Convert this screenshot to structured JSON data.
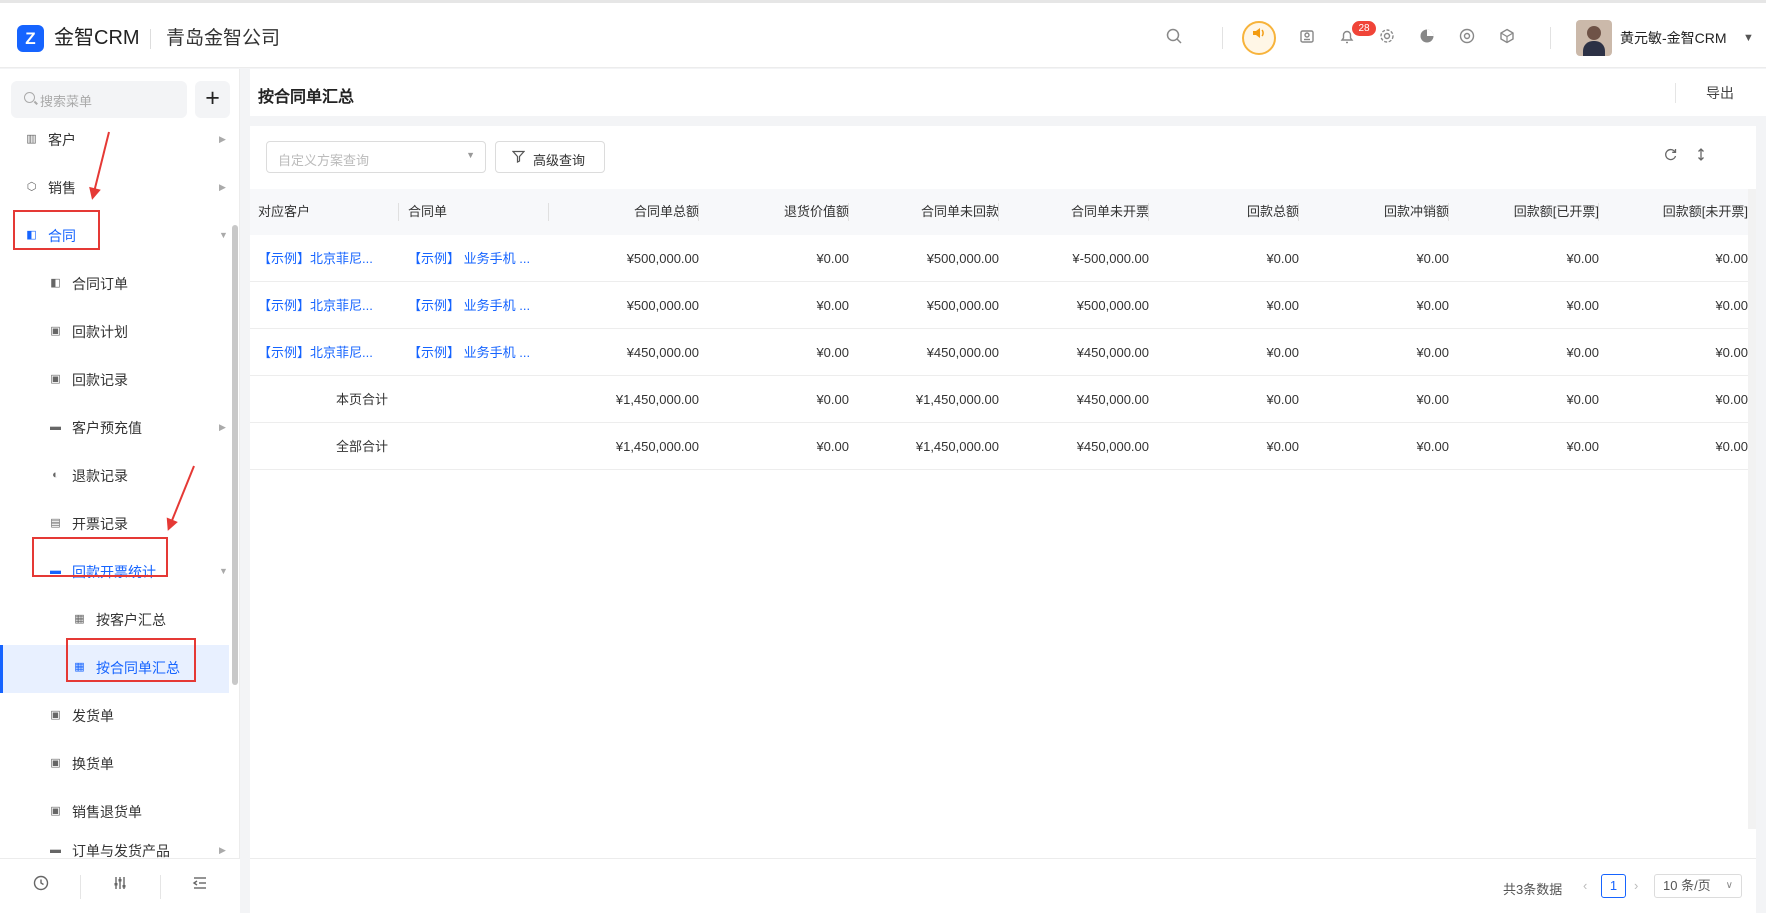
{
  "header": {
    "logo_glyph": "Z",
    "app_name": "金智CRM",
    "company": "青岛金智公司",
    "notification_count": "28",
    "user_name": "黄元敏-金智CRM",
    "icons": [
      "search-icon",
      "speaker-icon",
      "contacts-icon",
      "bell-icon",
      "gear-icon",
      "pie-chart-icon",
      "chrome-icon",
      "cube-icon"
    ]
  },
  "sidebar": {
    "search_placeholder": "搜索菜单",
    "add_label": "+",
    "items": [
      {
        "label": "客户",
        "icon": "building-icon"
      },
      {
        "label": "销售",
        "icon": "hexagon-icon"
      },
      {
        "label": "合同",
        "icon": "contract-icon"
      },
      {
        "label": "合同订单",
        "icon": "doc-icon"
      },
      {
        "label": "回款计划",
        "icon": "briefcase-icon"
      },
      {
        "label": "回款记录",
        "icon": "briefcase-icon"
      },
      {
        "label": "客户预充值",
        "icon": "folder-icon"
      },
      {
        "label": "退款记录",
        "icon": "refund-icon"
      },
      {
        "label": "开票记录",
        "icon": "invoice-icon"
      },
      {
        "label": "回款开票统计",
        "icon": "folder-icon"
      },
      {
        "label": "按客户汇总",
        "icon": "calculator-icon"
      },
      {
        "label": "按合同单汇总",
        "icon": "calculator-icon"
      },
      {
        "label": "发货单",
        "icon": "box-icon"
      },
      {
        "label": "换货单",
        "icon": "box-icon"
      },
      {
        "label": "销售退货单",
        "icon": "box-icon"
      },
      {
        "label": "订单与发货产品",
        "icon": "folder-icon"
      }
    ]
  },
  "page": {
    "title": "按合同单汇总",
    "export_label": "导出"
  },
  "toolbar": {
    "scheme_placeholder": "自定义方案查询",
    "advanced_query_label": "高级查询"
  },
  "table": {
    "columns": [
      "对应客户",
      "合同单",
      "合同单总额",
      "退货价值额",
      "合同单未回款",
      "合同单未开票",
      "回款总额",
      "回款冲销额",
      "回款额[已开票]",
      "回款额[未开票]"
    ],
    "rows": [
      [
        "【示例】北京菲尼...",
        "【示例】 业务手机 ...",
        "¥500,000.00",
        "¥0.00",
        "¥500,000.00",
        "¥-500,000.00",
        "¥0.00",
        "¥0.00",
        "¥0.00",
        "¥0.00"
      ],
      [
        "【示例】北京菲尼...",
        "【示例】 业务手机 ...",
        "¥500,000.00",
        "¥0.00",
        "¥500,000.00",
        "¥500,000.00",
        "¥0.00",
        "¥0.00",
        "¥0.00",
        "¥0.00"
      ],
      [
        "【示例】北京菲尼...",
        "【示例】 业务手机 ...",
        "¥450,000.00",
        "¥0.00",
        "¥450,000.00",
        "¥450,000.00",
        "¥0.00",
        "¥0.00",
        "¥0.00",
        "¥0.00"
      ]
    ],
    "totals": [
      {
        "label": "本页合计",
        "values": [
          "¥1,450,000.00",
          "¥0.00",
          "¥1,450,000.00",
          "¥450,000.00",
          "¥0.00",
          "¥0.00",
          "¥0.00",
          "¥0.00"
        ]
      },
      {
        "label": "全部合计",
        "values": [
          "¥1,450,000.00",
          "¥0.00",
          "¥1,450,000.00",
          "¥450,000.00",
          "¥0.00",
          "¥0.00",
          "¥0.00",
          "¥0.00"
        ]
      }
    ]
  },
  "pagination": {
    "total_text": "共3条数据",
    "current_page": "1",
    "page_size": "10 条/页"
  },
  "colors": {
    "accent": "#1664ff",
    "annotation": "#e53935",
    "badge": "#f04438"
  }
}
